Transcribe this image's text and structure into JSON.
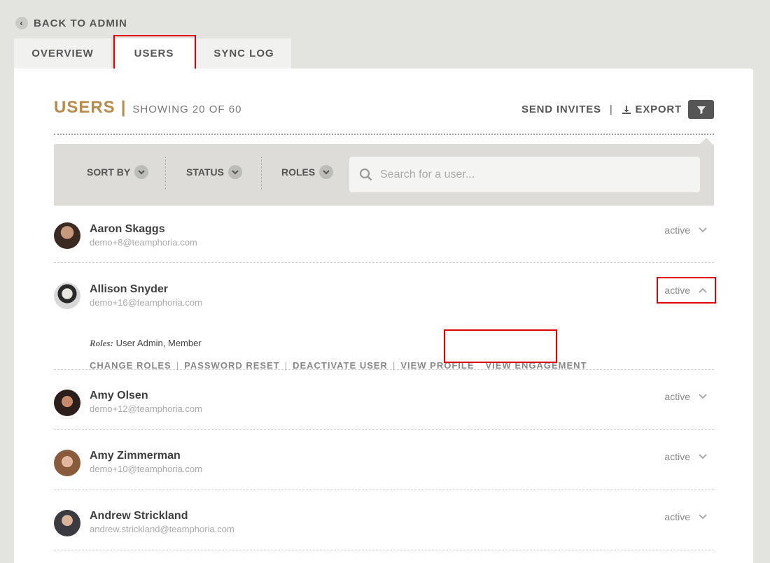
{
  "nav": {
    "back_label": "BACK TO ADMIN"
  },
  "tabs": [
    {
      "label": "OVERVIEW"
    },
    {
      "label": "USERS"
    },
    {
      "label": "SYNC LOG"
    }
  ],
  "header": {
    "title": "USERS",
    "separator": "|",
    "subtitle": "SHOWING 20 OF 60",
    "send_invites": "SEND INVITES",
    "action_separator": "|",
    "export": "EXPORT"
  },
  "filters": {
    "sort_by": "SORT BY",
    "status": "STATUS",
    "roles": "ROLES",
    "search_placeholder": "Search for a user..."
  },
  "users": [
    {
      "name": "Aaron Skaggs",
      "email": "demo+8@teamphoria.com",
      "status": "active"
    },
    {
      "name": "Allison Snyder",
      "email": "demo+16@teamphoria.com",
      "status": "active",
      "roles_label": "Roles:",
      "roles": "User Admin, Member",
      "actions": [
        "CHANGE ROLES",
        "PASSWORD RESET",
        "DEACTIVATE USER",
        "VIEW PROFILE",
        "VIEW ENGAGEMENT"
      ],
      "action_separator": "|"
    },
    {
      "name": "Amy Olsen",
      "email": "demo+12@teamphoria.com",
      "status": "active"
    },
    {
      "name": "Amy Zimmerman",
      "email": "demo+10@teamphoria.com",
      "status": "active"
    },
    {
      "name": "Andrew Strickland",
      "email": "andrew.strickland@teamphoria.com",
      "status": "active"
    }
  ],
  "colors": {
    "accent": "#b88b4a",
    "highlight": "#e00000",
    "background": "#e3e3df"
  }
}
